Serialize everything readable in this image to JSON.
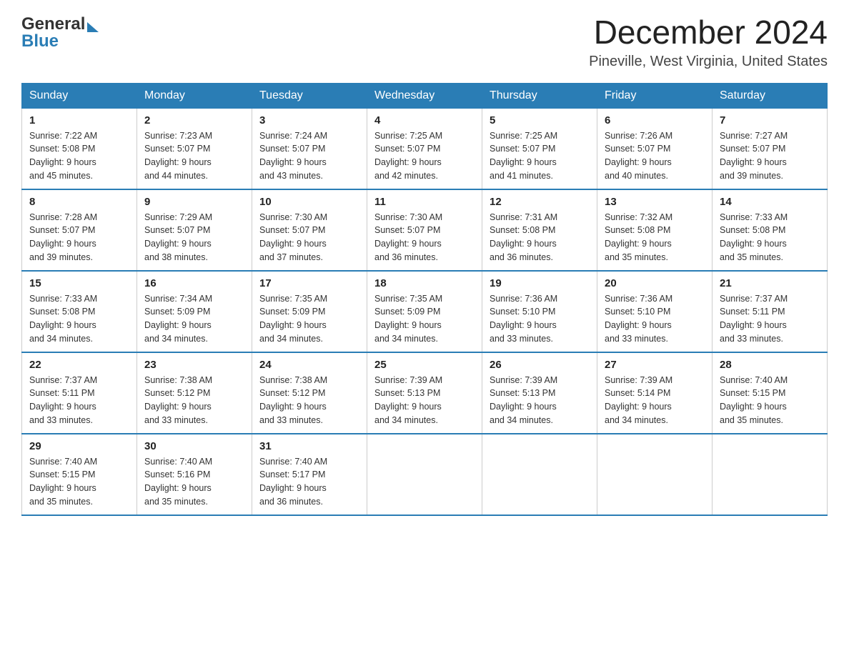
{
  "header": {
    "logo_general": "General",
    "logo_blue": "Blue",
    "title": "December 2024",
    "location": "Pineville, West Virginia, United States"
  },
  "calendar": {
    "days_of_week": [
      "Sunday",
      "Monday",
      "Tuesday",
      "Wednesday",
      "Thursday",
      "Friday",
      "Saturday"
    ],
    "weeks": [
      [
        {
          "day": "1",
          "sunrise": "Sunrise: 7:22 AM",
          "sunset": "Sunset: 5:08 PM",
          "daylight": "Daylight: 9 hours",
          "daylight2": "and 45 minutes."
        },
        {
          "day": "2",
          "sunrise": "Sunrise: 7:23 AM",
          "sunset": "Sunset: 5:07 PM",
          "daylight": "Daylight: 9 hours",
          "daylight2": "and 44 minutes."
        },
        {
          "day": "3",
          "sunrise": "Sunrise: 7:24 AM",
          "sunset": "Sunset: 5:07 PM",
          "daylight": "Daylight: 9 hours",
          "daylight2": "and 43 minutes."
        },
        {
          "day": "4",
          "sunrise": "Sunrise: 7:25 AM",
          "sunset": "Sunset: 5:07 PM",
          "daylight": "Daylight: 9 hours",
          "daylight2": "and 42 minutes."
        },
        {
          "day": "5",
          "sunrise": "Sunrise: 7:25 AM",
          "sunset": "Sunset: 5:07 PM",
          "daylight": "Daylight: 9 hours",
          "daylight2": "and 41 minutes."
        },
        {
          "day": "6",
          "sunrise": "Sunrise: 7:26 AM",
          "sunset": "Sunset: 5:07 PM",
          "daylight": "Daylight: 9 hours",
          "daylight2": "and 40 minutes."
        },
        {
          "day": "7",
          "sunrise": "Sunrise: 7:27 AM",
          "sunset": "Sunset: 5:07 PM",
          "daylight": "Daylight: 9 hours",
          "daylight2": "and 39 minutes."
        }
      ],
      [
        {
          "day": "8",
          "sunrise": "Sunrise: 7:28 AM",
          "sunset": "Sunset: 5:07 PM",
          "daylight": "Daylight: 9 hours",
          "daylight2": "and 39 minutes."
        },
        {
          "day": "9",
          "sunrise": "Sunrise: 7:29 AM",
          "sunset": "Sunset: 5:07 PM",
          "daylight": "Daylight: 9 hours",
          "daylight2": "and 38 minutes."
        },
        {
          "day": "10",
          "sunrise": "Sunrise: 7:30 AM",
          "sunset": "Sunset: 5:07 PM",
          "daylight": "Daylight: 9 hours",
          "daylight2": "and 37 minutes."
        },
        {
          "day": "11",
          "sunrise": "Sunrise: 7:30 AM",
          "sunset": "Sunset: 5:07 PM",
          "daylight": "Daylight: 9 hours",
          "daylight2": "and 36 minutes."
        },
        {
          "day": "12",
          "sunrise": "Sunrise: 7:31 AM",
          "sunset": "Sunset: 5:08 PM",
          "daylight": "Daylight: 9 hours",
          "daylight2": "and 36 minutes."
        },
        {
          "day": "13",
          "sunrise": "Sunrise: 7:32 AM",
          "sunset": "Sunset: 5:08 PM",
          "daylight": "Daylight: 9 hours",
          "daylight2": "and 35 minutes."
        },
        {
          "day": "14",
          "sunrise": "Sunrise: 7:33 AM",
          "sunset": "Sunset: 5:08 PM",
          "daylight": "Daylight: 9 hours",
          "daylight2": "and 35 minutes."
        }
      ],
      [
        {
          "day": "15",
          "sunrise": "Sunrise: 7:33 AM",
          "sunset": "Sunset: 5:08 PM",
          "daylight": "Daylight: 9 hours",
          "daylight2": "and 34 minutes."
        },
        {
          "day": "16",
          "sunrise": "Sunrise: 7:34 AM",
          "sunset": "Sunset: 5:09 PM",
          "daylight": "Daylight: 9 hours",
          "daylight2": "and 34 minutes."
        },
        {
          "day": "17",
          "sunrise": "Sunrise: 7:35 AM",
          "sunset": "Sunset: 5:09 PM",
          "daylight": "Daylight: 9 hours",
          "daylight2": "and 34 minutes."
        },
        {
          "day": "18",
          "sunrise": "Sunrise: 7:35 AM",
          "sunset": "Sunset: 5:09 PM",
          "daylight": "Daylight: 9 hours",
          "daylight2": "and 34 minutes."
        },
        {
          "day": "19",
          "sunrise": "Sunrise: 7:36 AM",
          "sunset": "Sunset: 5:10 PM",
          "daylight": "Daylight: 9 hours",
          "daylight2": "and 33 minutes."
        },
        {
          "day": "20",
          "sunrise": "Sunrise: 7:36 AM",
          "sunset": "Sunset: 5:10 PM",
          "daylight": "Daylight: 9 hours",
          "daylight2": "and 33 minutes."
        },
        {
          "day": "21",
          "sunrise": "Sunrise: 7:37 AM",
          "sunset": "Sunset: 5:11 PM",
          "daylight": "Daylight: 9 hours",
          "daylight2": "and 33 minutes."
        }
      ],
      [
        {
          "day": "22",
          "sunrise": "Sunrise: 7:37 AM",
          "sunset": "Sunset: 5:11 PM",
          "daylight": "Daylight: 9 hours",
          "daylight2": "and 33 minutes."
        },
        {
          "day": "23",
          "sunrise": "Sunrise: 7:38 AM",
          "sunset": "Sunset: 5:12 PM",
          "daylight": "Daylight: 9 hours",
          "daylight2": "and 33 minutes."
        },
        {
          "day": "24",
          "sunrise": "Sunrise: 7:38 AM",
          "sunset": "Sunset: 5:12 PM",
          "daylight": "Daylight: 9 hours",
          "daylight2": "and 33 minutes."
        },
        {
          "day": "25",
          "sunrise": "Sunrise: 7:39 AM",
          "sunset": "Sunset: 5:13 PM",
          "daylight": "Daylight: 9 hours",
          "daylight2": "and 34 minutes."
        },
        {
          "day": "26",
          "sunrise": "Sunrise: 7:39 AM",
          "sunset": "Sunset: 5:13 PM",
          "daylight": "Daylight: 9 hours",
          "daylight2": "and 34 minutes."
        },
        {
          "day": "27",
          "sunrise": "Sunrise: 7:39 AM",
          "sunset": "Sunset: 5:14 PM",
          "daylight": "Daylight: 9 hours",
          "daylight2": "and 34 minutes."
        },
        {
          "day": "28",
          "sunrise": "Sunrise: 7:40 AM",
          "sunset": "Sunset: 5:15 PM",
          "daylight": "Daylight: 9 hours",
          "daylight2": "and 35 minutes."
        }
      ],
      [
        {
          "day": "29",
          "sunrise": "Sunrise: 7:40 AM",
          "sunset": "Sunset: 5:15 PM",
          "daylight": "Daylight: 9 hours",
          "daylight2": "and 35 minutes."
        },
        {
          "day": "30",
          "sunrise": "Sunrise: 7:40 AM",
          "sunset": "Sunset: 5:16 PM",
          "daylight": "Daylight: 9 hours",
          "daylight2": "and 35 minutes."
        },
        {
          "day": "31",
          "sunrise": "Sunrise: 7:40 AM",
          "sunset": "Sunset: 5:17 PM",
          "daylight": "Daylight: 9 hours",
          "daylight2": "and 36 minutes."
        },
        null,
        null,
        null,
        null
      ]
    ]
  }
}
